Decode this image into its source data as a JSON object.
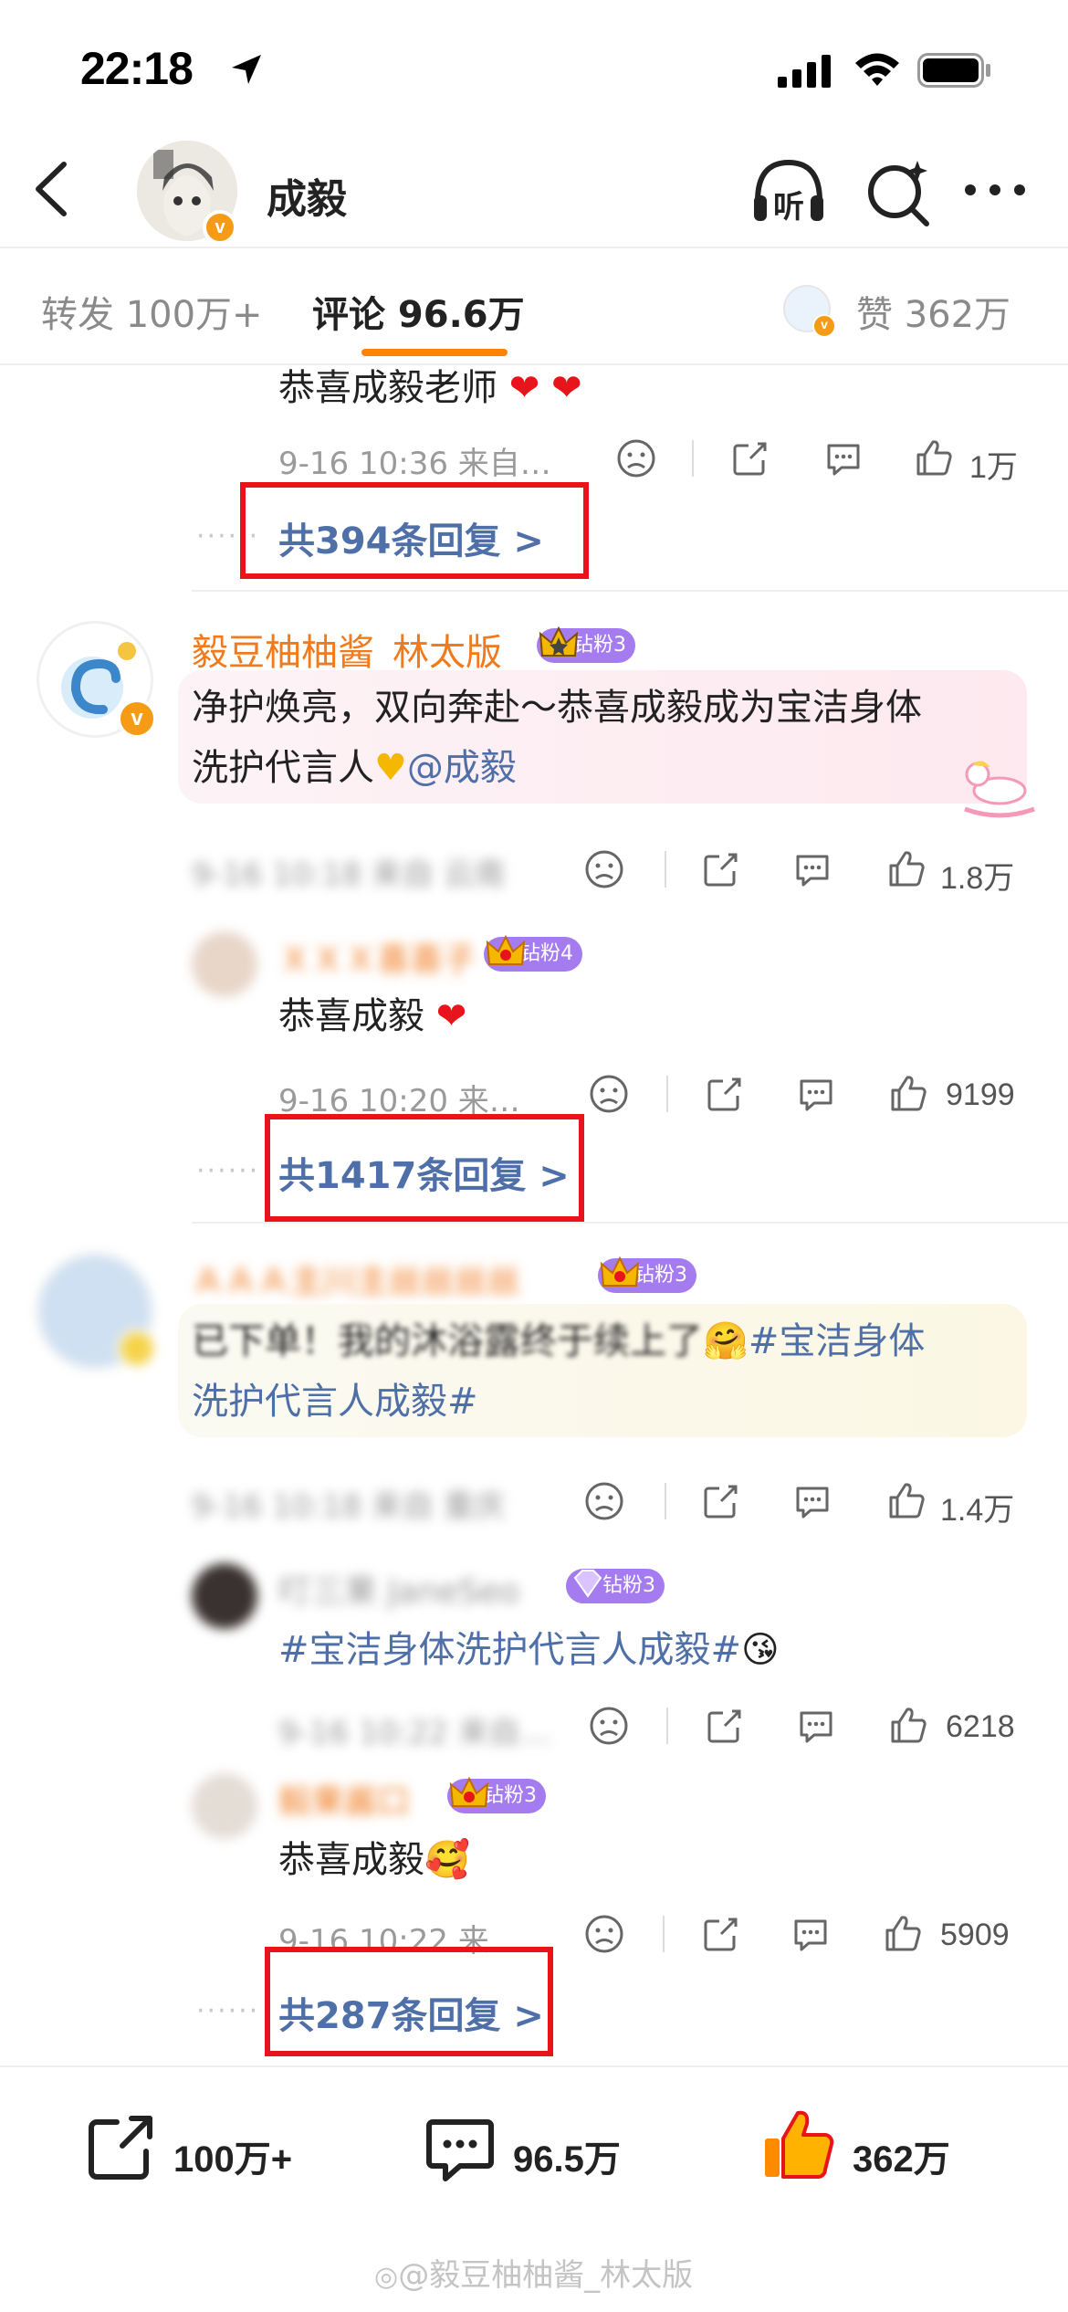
{
  "status_bar": {
    "time": "22:18"
  },
  "nav": {
    "title": "成毅",
    "listen_label": "听"
  },
  "tabs": [
    {
      "label": "转发 100万+"
    },
    {
      "label": "评论 96.6万"
    },
    {
      "label": "赞 362万"
    }
  ],
  "comments": {
    "c0": {
      "text": "恭喜成毅老师",
      "time": "9-16 10:36  来自…",
      "likes": "1万",
      "replies_link": "共394条回复 >"
    },
    "c1": {
      "username": "毅豆柚柚酱_林太版",
      "badge": "钻粉3",
      "text_line1": "净护焕亮，双向奔赴～恭喜成毅成为宝洁身体",
      "text_line2": "洗护代言人",
      "mention": "@成毅",
      "time": "9-16 10:18  来自 云南",
      "likes": "1.8万"
    },
    "c1r": {
      "username": "ＸＸＸ喜喜子",
      "badge": "钻粉4",
      "text": "恭喜成毅",
      "time": "9-16 10:20  来…",
      "likes": "9199",
      "replies_link": "共1417条回复 >"
    },
    "c2": {
      "username": "ＡＡＡ主川主丝丝丝丝",
      "badge": "钻粉3",
      "text_prefix": "已下单！我的沐浴露终于续上了",
      "topic_part1": "#宝洁身体",
      "topic_part2": "洗护代言人成毅#",
      "time": "9-16 10:18  来自 重庆",
      "likes": "1.4万"
    },
    "c2r1": {
      "username": "叮三果 JaneSeo",
      "badge": "钻粉3",
      "topic": "#宝洁身体洗护代言人成毅#",
      "time": "9-16 10:22  来自…",
      "likes": "6218"
    },
    "c2r2": {
      "username": "毅果酱口",
      "badge": "钻粉3",
      "text": "恭喜成毅",
      "time": "9-16 10:22  来…",
      "likes": "5909",
      "replies_link": "共287条回复 >"
    }
  },
  "bottom_bar": {
    "repost_count": "100万+",
    "comment_count": "96.5万",
    "like_count": "362万",
    "watermark": "@毅豆柚柚酱_林太版"
  },
  "colors": {
    "accent": "#ff8200",
    "link": "#4f6fa8",
    "username": "#f07a1e",
    "highlight_box": "#e8141b",
    "verified": "#f59b16"
  }
}
